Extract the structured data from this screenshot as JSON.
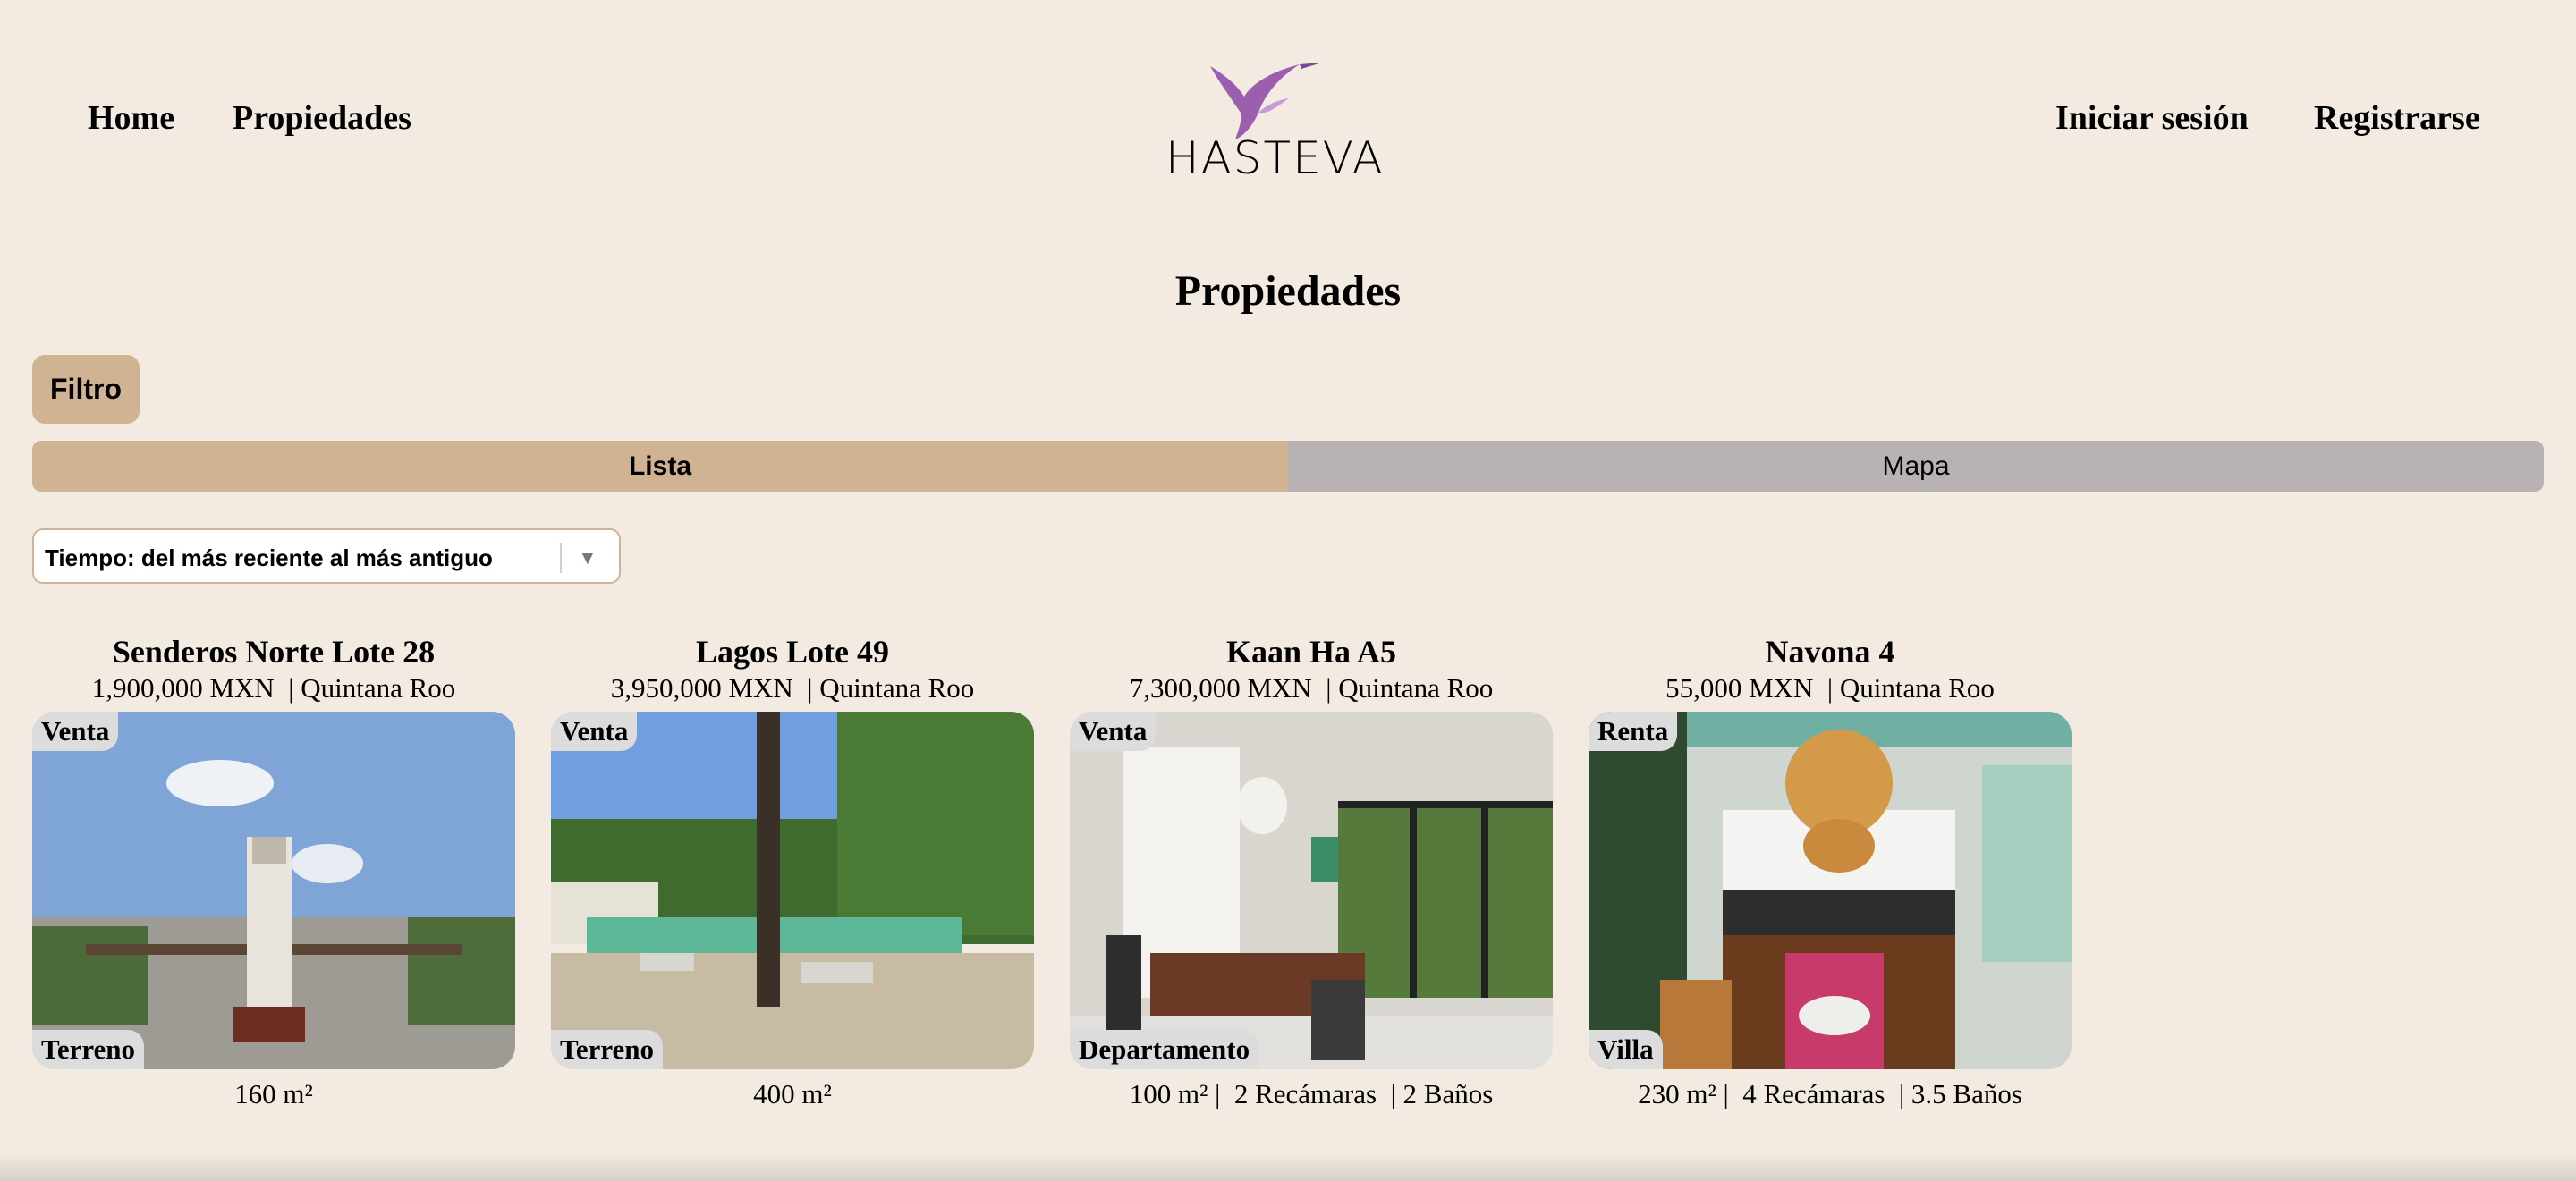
{
  "nav": {
    "home": "Home",
    "properties": "Propiedades",
    "login": "Iniciar sesión",
    "register": "Registrarse"
  },
  "logo": {
    "text": "HASTEVA",
    "icon": "hummingbird-logo"
  },
  "page_title": "Propiedades",
  "filter_label": "Filtro",
  "tabs": {
    "list": "Lista",
    "map": "Mapa"
  },
  "sort": {
    "selected": "Tiempo: del más reciente al más antiguo"
  },
  "colors": {
    "background": "#f3ebe1",
    "accent": "#cfb393",
    "inactive_tab": "#b8b2b3",
    "logo": "#9c5fb0"
  },
  "listings": [
    {
      "title": "Senderos Norte Lote 28",
      "price": "1,900,000 MXN",
      "location": "Quintana Roo",
      "operation": "Venta",
      "type": "Terreno",
      "area": "160 m²",
      "bedrooms": "",
      "bathrooms": ""
    },
    {
      "title": "Lagos Lote 49",
      "price": "3,950,000 MXN",
      "location": "Quintana Roo",
      "operation": "Venta",
      "type": "Terreno",
      "area": "400 m²",
      "bedrooms": "",
      "bathrooms": ""
    },
    {
      "title": "Kaan Ha A5",
      "price": "7,300,000 MXN",
      "location": "Quintana Roo",
      "operation": "Venta",
      "type": "Departamento",
      "area": "100 m²",
      "bedrooms": "2 Recámaras",
      "bathrooms": "2 Baños"
    },
    {
      "title": "Navona 4",
      "price": "55,000 MXN",
      "location": "Quintana Roo",
      "operation": "Renta",
      "type": "Villa",
      "area": "230 m²",
      "bedrooms": "4 Recámaras",
      "bathrooms": "3.5 Baños"
    }
  ]
}
